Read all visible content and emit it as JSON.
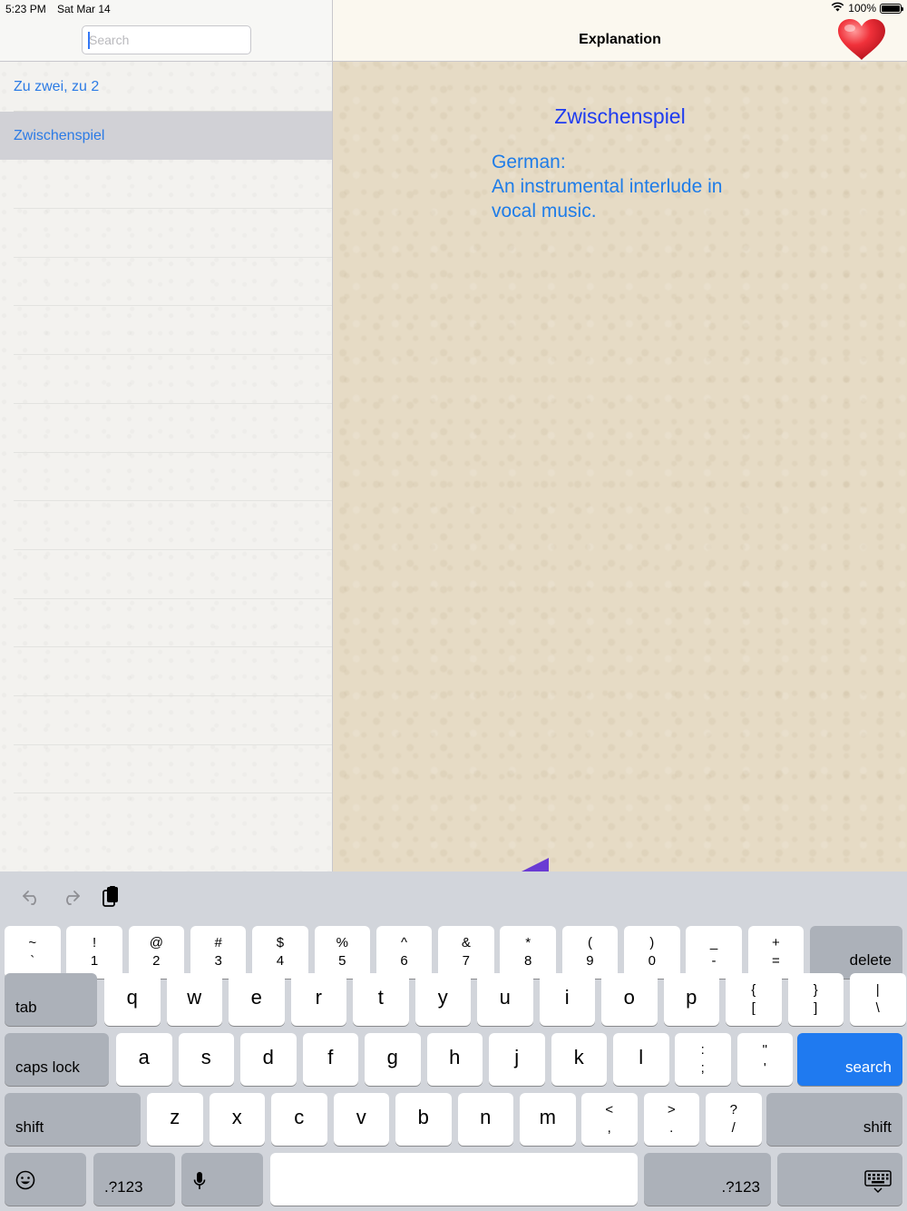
{
  "status_bar": {
    "time": "5:23 PM",
    "date": "Sat Mar 14",
    "battery": "100%"
  },
  "sidebar": {
    "search": {
      "placeholder": "Search",
      "value": ""
    },
    "items": [
      {
        "label": "Zu zwei, zu 2",
        "selected": false
      },
      {
        "label": "Zwischenspiel",
        "selected": true
      }
    ]
  },
  "detail": {
    "title": "Explanation",
    "term": "Zwischenspiel",
    "definition_lines": [
      "German:",
      "An instrumental interlude in",
      "vocal music."
    ],
    "favorite_icon": "heart-icon",
    "favorite_color": "#e8222e"
  },
  "keyboard": {
    "toolbar": [
      "undo-icon",
      "redo-icon",
      "paste-icon"
    ],
    "row1": [
      {
        "top": "~",
        "bottom": "`"
      },
      {
        "top": "!",
        "bottom": "1"
      },
      {
        "top": "@",
        "bottom": "2"
      },
      {
        "top": "#",
        "bottom": "3"
      },
      {
        "top": "$",
        "bottom": "4"
      },
      {
        "top": "%",
        "bottom": "5"
      },
      {
        "top": "^",
        "bottom": "6"
      },
      {
        "top": "&",
        "bottom": "7"
      },
      {
        "top": "*",
        "bottom": "8"
      },
      {
        "top": "(",
        "bottom": "9"
      },
      {
        "top": ")",
        "bottom": "0"
      },
      {
        "top": "_",
        "bottom": "-"
      },
      {
        "top": "+",
        "bottom": "="
      }
    ],
    "delete_label": "delete",
    "tab_label": "tab",
    "row2": [
      "q",
      "w",
      "e",
      "r",
      "t",
      "y",
      "u",
      "i",
      "o",
      "p"
    ],
    "row2_symbols": [
      {
        "top": "{",
        "bottom": "["
      },
      {
        "top": "}",
        "bottom": "]"
      },
      {
        "top": "|",
        "bottom": "\\"
      }
    ],
    "caps_label": "caps lock",
    "row3": [
      "a",
      "s",
      "d",
      "f",
      "g",
      "h",
      "j",
      "k",
      "l"
    ],
    "row3_symbols": [
      {
        "top": ":",
        "bottom": ";"
      },
      {
        "top": "\"",
        "bottom": "'"
      }
    ],
    "search_label": "search",
    "search_color": "#1f7af0",
    "shift_label": "shift",
    "row4": [
      "z",
      "x",
      "c",
      "v",
      "b",
      "n",
      "m"
    ],
    "row4_symbols": [
      {
        "top": "<",
        "bottom": ","
      },
      {
        "top": ">",
        "bottom": "."
      },
      {
        "top": "?",
        "bottom": "/"
      }
    ],
    "numbers_label": ".?123",
    "bottom_icons": [
      "emoji-icon",
      "microphone-icon",
      "keyboard-hide-icon"
    ]
  }
}
